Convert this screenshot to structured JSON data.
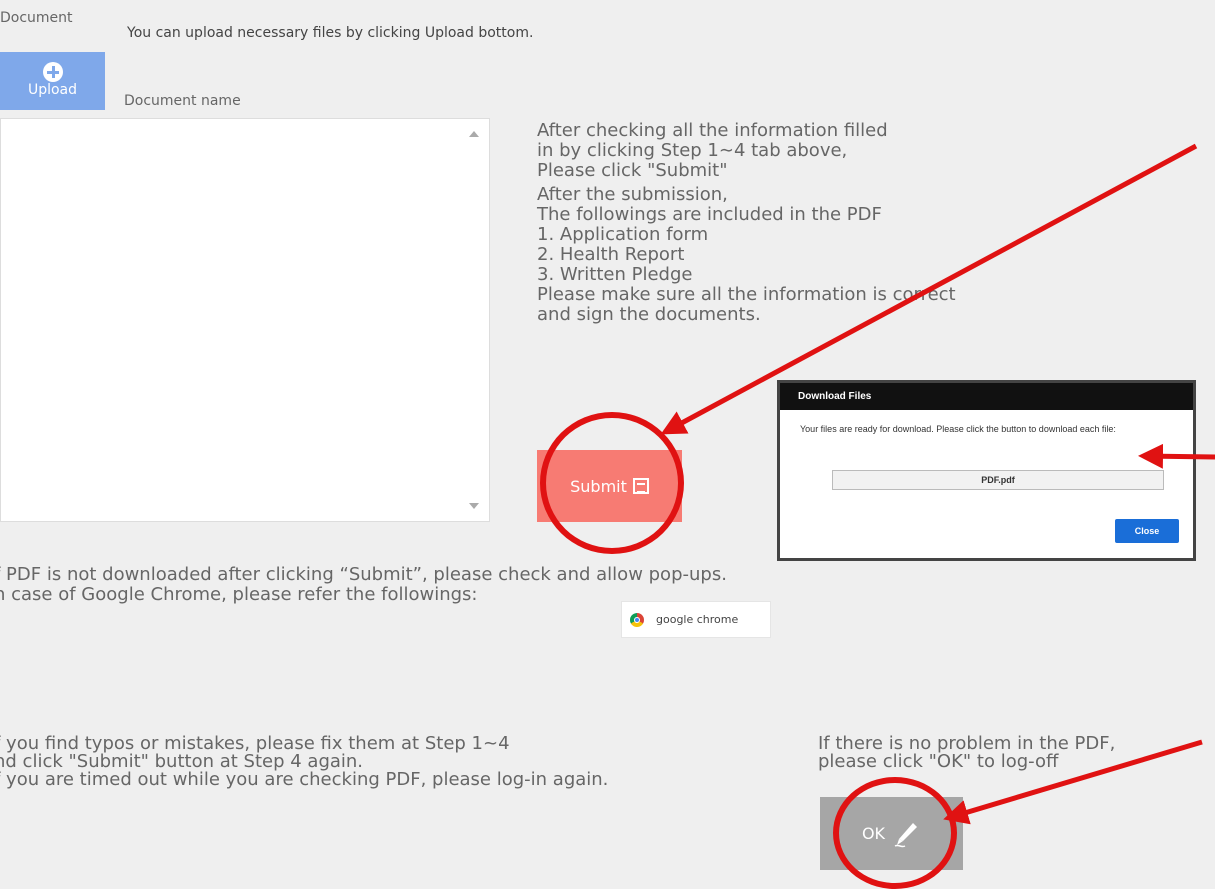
{
  "document": {
    "label": "Document",
    "upload_hint": "You can upload necessary files by clicking Upload bottom.",
    "upload_label": "Upload",
    "name_column": "Document name"
  },
  "instructions": {
    "lines_a": [
      "After checking all the information filled",
      "in by clicking Step 1∼4 tab above,",
      "Please click \"Submit\""
    ],
    "lines_b": [
      "After the submission,",
      "The followings are included in the PDF",
      "1. Application form",
      "2. Health Report",
      "3. Written Pledge",
      "Please make sure all the information is correct",
      "and sign the documents."
    ]
  },
  "submit": {
    "label": "Submit",
    "icon": "document-icon"
  },
  "popup": {
    "title": "Download Files",
    "message": "Your files are ready for download. Please click the button to download each file:",
    "file_button": "PDF.pdf",
    "close_button": "Close"
  },
  "popup_notice": {
    "line1": "f PDF is not downloaded after clicking “Submit”, please check and allow pop-ups.",
    "line2": "n case of Google Chrome, please refer the followings:"
  },
  "chrome_link": {
    "label": "google chrome",
    "icon": "chrome-icon"
  },
  "fix_notice": [
    "f you find typos or mistakes, please fix them at Step 1~4",
    "nd click \"Submit\" button at Step 4 again.",
    "f you are timed out while you are checking PDF, please log-in again."
  ],
  "logoff_notice": [
    "If there is no problem in the PDF,",
    "please click \"OK\" to log-off"
  ],
  "ok": {
    "label": "OK",
    "icon": "pen-icon"
  },
  "colors": {
    "background": "#efefef",
    "upload": "#7fa8ea",
    "submit": "#f77b73",
    "ok": "#a6a6a6",
    "annotation": "#e01212",
    "popup_close": "#1a6ed8"
  }
}
